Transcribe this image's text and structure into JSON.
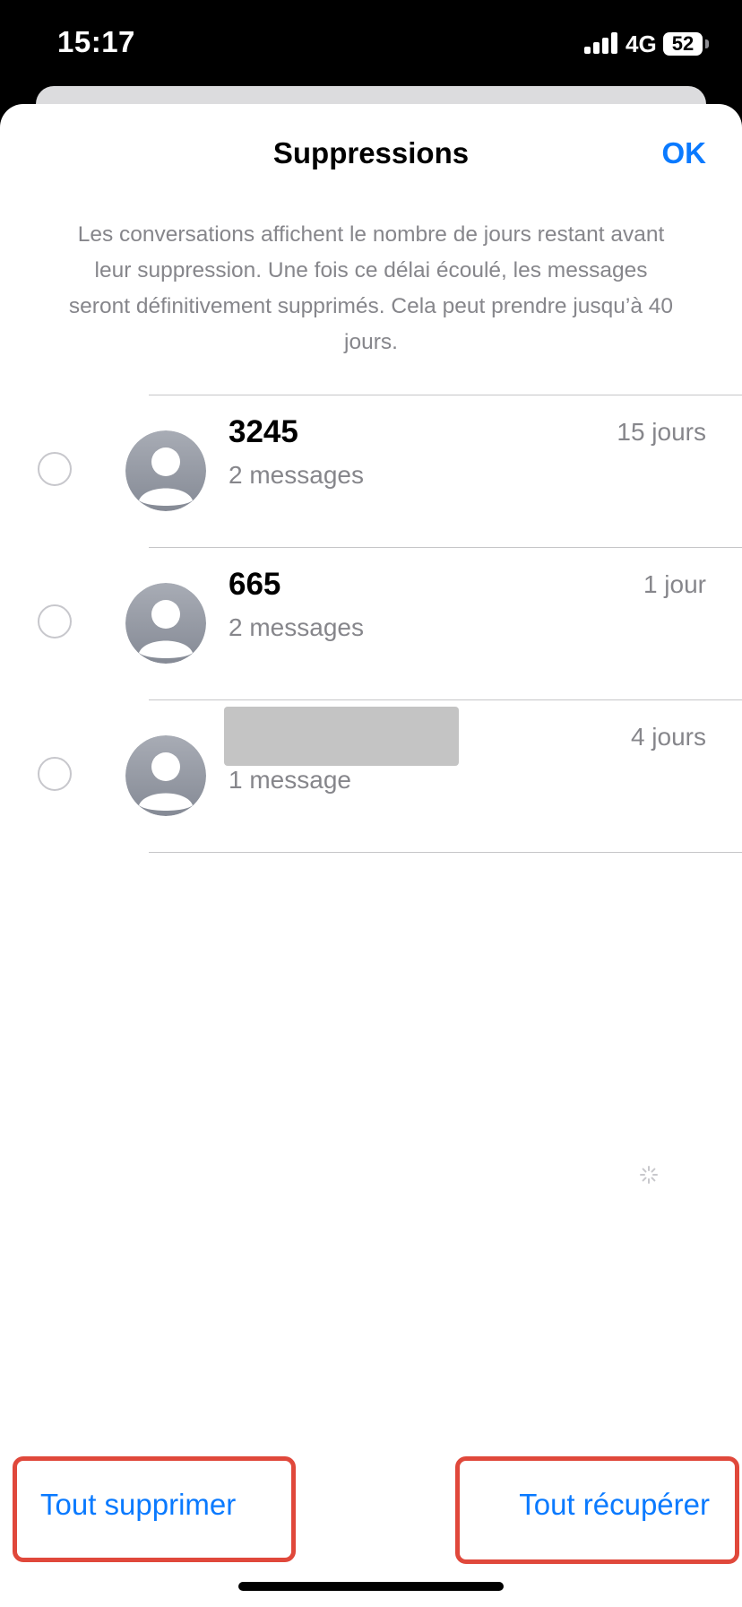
{
  "status_bar": {
    "time": "15:17",
    "network": "4G",
    "battery": "52"
  },
  "sheet": {
    "title": "Suppressions",
    "done_label": "OK",
    "info": "Les conversations affichent le nombre de jours restant avant leur suppression. Une fois ce délai écoulé, les messages seront définitivement supprimés. Cela peut prendre jusqu’à 40 jours."
  },
  "conversations": [
    {
      "name": "3245",
      "subtitle": "2 messages",
      "days": "15 jours"
    },
    {
      "name": "665",
      "subtitle": "2 messages",
      "days": "1 jour"
    },
    {
      "name": "",
      "subtitle": "1 message",
      "days": "4 jours",
      "name_redacted": true
    }
  ],
  "actions": {
    "delete_all": "Tout supprimer",
    "recover_all": "Tout récupérer"
  },
  "colors": {
    "accent": "#0a7aff",
    "highlight_border": "#e0483b",
    "avatar": "#9a9ea8"
  },
  "icons": {
    "signal": "signal-icon",
    "battery": "battery-icon",
    "avatar": "person-icon",
    "select": "circle-icon",
    "loading": "spinner-icon"
  }
}
